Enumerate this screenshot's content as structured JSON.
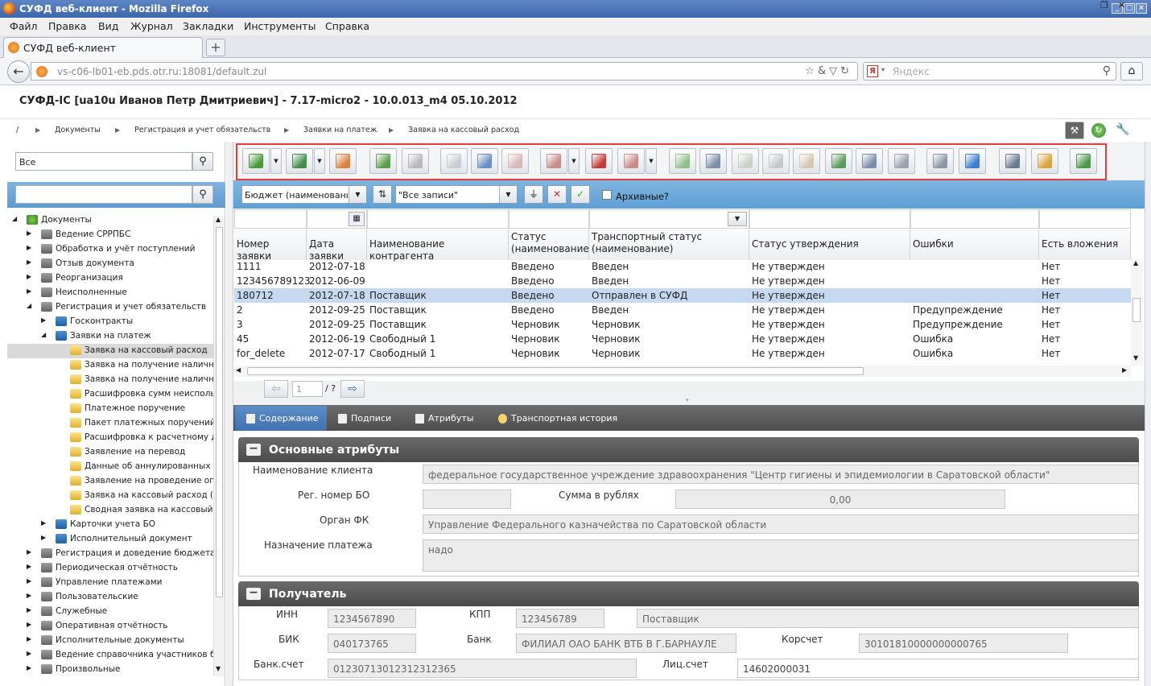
{
  "window": {
    "title": "СУФД веб-клиент - Mozilla Firefox"
  },
  "menu": [
    "Файл",
    "Правка",
    "Вид",
    "Журнал",
    "Закладки",
    "Инструменты",
    "Справка"
  ],
  "browser_tab": {
    "label": "СУФД веб-клиент",
    "new_tab": "+"
  },
  "address": {
    "url": "vs-c06-lb01-eb.pds.otr.ru:18081/default.zul",
    "search_placeholder": "Яндекс"
  },
  "app": {
    "title": "СУФД-IC [ua10u Иванов Петр Дмитриевич] - 7.17-micro2 - 10.0.013_m4 05.10.2012"
  },
  "breadcrumb": [
    "/",
    "Документы",
    "Регистрация и учет обязательств",
    "Заявки на платеж",
    "Заявка на кассовый расход"
  ],
  "left": {
    "search1_value": "Все",
    "search2_value": "",
    "tree": [
      {
        "label": "Документы",
        "level": 0,
        "icon": "root",
        "expanded": true
      },
      {
        "label": "Ведение СРРПБС",
        "level": 1,
        "icon": "grey"
      },
      {
        "label": "Обработка и учёт поступлений",
        "level": 1,
        "icon": "grey"
      },
      {
        "label": "Отзыв документа",
        "level": 1,
        "icon": "grey"
      },
      {
        "label": "Реорганизация",
        "level": 1,
        "icon": "grey"
      },
      {
        "label": "Неисполненные",
        "level": 1,
        "icon": "grey"
      },
      {
        "label": "Регистрация и учет обязательств",
        "level": 1,
        "icon": "grey",
        "expanded": true
      },
      {
        "label": "Госконтракты",
        "level": 2,
        "icon": "blue"
      },
      {
        "label": "Заявки на платеж",
        "level": 2,
        "icon": "blue",
        "expanded": true
      },
      {
        "label": "Заявка на кассовый расход",
        "level": 3,
        "icon": "yel",
        "selected": true
      },
      {
        "label": "Заявка на получение наличных",
        "level": 3,
        "icon": "yel"
      },
      {
        "label": "Заявка на получение наличных",
        "level": 3,
        "icon": "yel"
      },
      {
        "label": "Расшифровка сумм неиспольз",
        "level": 3,
        "icon": "yel"
      },
      {
        "label": "Платежное поручение",
        "level": 3,
        "icon": "yel"
      },
      {
        "label": "Пакет платежных поручений",
        "level": 3,
        "icon": "yel"
      },
      {
        "label": "Расшифровка к расчетному до",
        "level": 3,
        "icon": "yel"
      },
      {
        "label": "Заявление на перевод",
        "level": 3,
        "icon": "yel"
      },
      {
        "label": "Данные об аннулированных че",
        "level": 3,
        "icon": "yel"
      },
      {
        "label": "Заявление на проведение опе",
        "level": 3,
        "icon": "yel"
      },
      {
        "label": "Заявка на кассовый расход (с",
        "level": 3,
        "icon": "yel"
      },
      {
        "label": "Сводная заявка на кассовый р",
        "level": 3,
        "icon": "yel"
      },
      {
        "label": "Карточки учета БО",
        "level": 2,
        "icon": "blue"
      },
      {
        "label": "Исполнительный документ",
        "level": 2,
        "icon": "blue"
      },
      {
        "label": "Регистрация и доведение бюджета",
        "level": 1,
        "icon": "grey"
      },
      {
        "label": "Периодическая отчётность",
        "level": 1,
        "icon": "grey"
      },
      {
        "label": "Управление платежами",
        "level": 1,
        "icon": "grey"
      },
      {
        "label": "Пользовательские",
        "level": 1,
        "icon": "grey"
      },
      {
        "label": "Служебные",
        "level": 1,
        "icon": "grey"
      },
      {
        "label": "Оперативная отчётность",
        "level": 1,
        "icon": "grey"
      },
      {
        "label": "Исполнительные документы",
        "level": 1,
        "icon": "grey"
      },
      {
        "label": "Ведение справочника участников бю",
        "level": 1,
        "icon": "grey"
      },
      {
        "label": "Произвольные",
        "level": 1,
        "icon": "grey"
      }
    ]
  },
  "toolbar_icons": [
    {
      "name": "import-icon",
      "color": "#4a9a3a",
      "dropdown": true
    },
    {
      "name": "export-icon",
      "color": "#3f8f4a",
      "dropdown": true
    },
    {
      "name": "new-document-icon",
      "color": "#d9843b"
    },
    {
      "name": "edit-document-icon",
      "color": "#5aa04a"
    },
    {
      "name": "settings-document-icon",
      "color": "#b8b8b8"
    },
    {
      "name": "view-document-icon",
      "color": "#c9ccd1"
    },
    {
      "name": "copy-document-icon",
      "color": "#6a8fc8"
    },
    {
      "name": "delete-document-icon",
      "color": "#d8b8b8"
    },
    {
      "name": "sign-document-icon",
      "color": "#c98a8a",
      "dropdown": true
    },
    {
      "name": "check-signature-icon",
      "color": "#c33a3a"
    },
    {
      "name": "remove-signature-icon",
      "color": "#c98a8a",
      "dropdown": true
    },
    {
      "name": "send-icon",
      "color": "#8fc08a"
    },
    {
      "name": "search-document-icon",
      "color": "#7a8fa8"
    },
    {
      "name": "message-icon",
      "color": "#c9d2c3"
    },
    {
      "name": "comment-icon",
      "color": "#c4c8cc"
    },
    {
      "name": "lock-icon",
      "color": "#d6c9b3"
    },
    {
      "name": "attach-icon",
      "color": "#5a9a5a"
    },
    {
      "name": "print-preview-icon",
      "color": "#7c8fa8"
    },
    {
      "name": "print-icon",
      "color": "#9aa2ab"
    },
    {
      "name": "find-icon",
      "color": "#8a96a5"
    },
    {
      "name": "refresh-icon",
      "color": "#3a7fd0"
    },
    {
      "name": "config-icon",
      "color": "#6a7c8f"
    },
    {
      "name": "report-icon",
      "color": "#d9a43b"
    },
    {
      "name": "exit-icon",
      "color": "#4a9a4a"
    }
  ],
  "filter": {
    "budget_combo": "Бюджет (наименование",
    "records_combo": "\"Все записи\"",
    "archive_label": "Архивные?"
  },
  "grid": {
    "columns": [
      "Номер заявки",
      "Дата заявки",
      "Наименование контрагента",
      "Статус (наименование)",
      "Транспортный статус (наименование)",
      "Статус утверждения",
      "Ошибки",
      "Есть вложения"
    ],
    "rows": [
      [
        "1111",
        "2012-07-18",
        "",
        "Введено",
        "Введен",
        "Не утвержден",
        "",
        "Нет"
      ],
      [
        "123456789123",
        "2012-06-09",
        "",
        "Введено",
        "Введен",
        "Не утвержден",
        "",
        "Нет"
      ],
      [
        "180712",
        "2012-07-18",
        "Поставщик",
        "Введено",
        "Отправлен в СУФД",
        "Не утвержден",
        "",
        "Нет"
      ],
      [
        "2",
        "2012-09-25",
        "Поставщик",
        "Введено",
        "Введен",
        "Не утвержден",
        "Предупреждение",
        "Нет"
      ],
      [
        "3",
        "2012-09-25",
        "Поставщик",
        "Черновик",
        "Черновик",
        "Не утвержден",
        "Предупреждение",
        "Нет"
      ],
      [
        "45",
        "2012-06-19",
        "Свободный 1",
        "Черновик",
        "Черновик",
        "Не утвержден",
        "Ошибка",
        "Нет"
      ],
      [
        "for_delete",
        "2012-07-17",
        "Свободный 1",
        "Черновик",
        "Черновик",
        "Не утвержден",
        "Ошибка",
        "Нет"
      ]
    ],
    "selected_row": 2
  },
  "pager": {
    "page": "1",
    "total": "/ ?"
  },
  "detail_tabs": [
    "Содержание",
    "Подписи",
    "Атрибуты",
    "Транспортная история"
  ],
  "sections": {
    "main": {
      "title": "Основные атрибуты",
      "client_label": "Наименование клиента",
      "client_value": "федеральное государственное учреждение здравоохранения \"Центр гигиены и эпидемиологии в Саратовской области\"",
      "reg_label": "Рег. номер БО",
      "reg_value": "",
      "sum_label": "Сумма в рублях",
      "sum_value": "0,00",
      "organ_label": "Орган ФК",
      "organ_value": "Управление Федерального казначейства по Саратовской области",
      "purpose_label": "Назначение платежа",
      "purpose_value": "надо"
    },
    "recipient": {
      "title": "Получатель",
      "inn_label": "ИНН",
      "inn_value": "1234567890",
      "kpp_label": "КПП",
      "kpp_value": "123456789",
      "name_value": "Поставщик",
      "bik_label": "БИК",
      "bik_value": "040173765",
      "bank_label": "Банк",
      "bank_value": "ФИЛИАЛ ОАО БАНК ВТБ В Г.БАРНАУЛЕ",
      "kor_label": "Корсчет",
      "kor_value": "30101810000000000765",
      "account_label": "Банк.счет",
      "account_value": "01230713012312312365",
      "lic_label": "Лиц.счет",
      "lic_value": "14602000031"
    }
  }
}
